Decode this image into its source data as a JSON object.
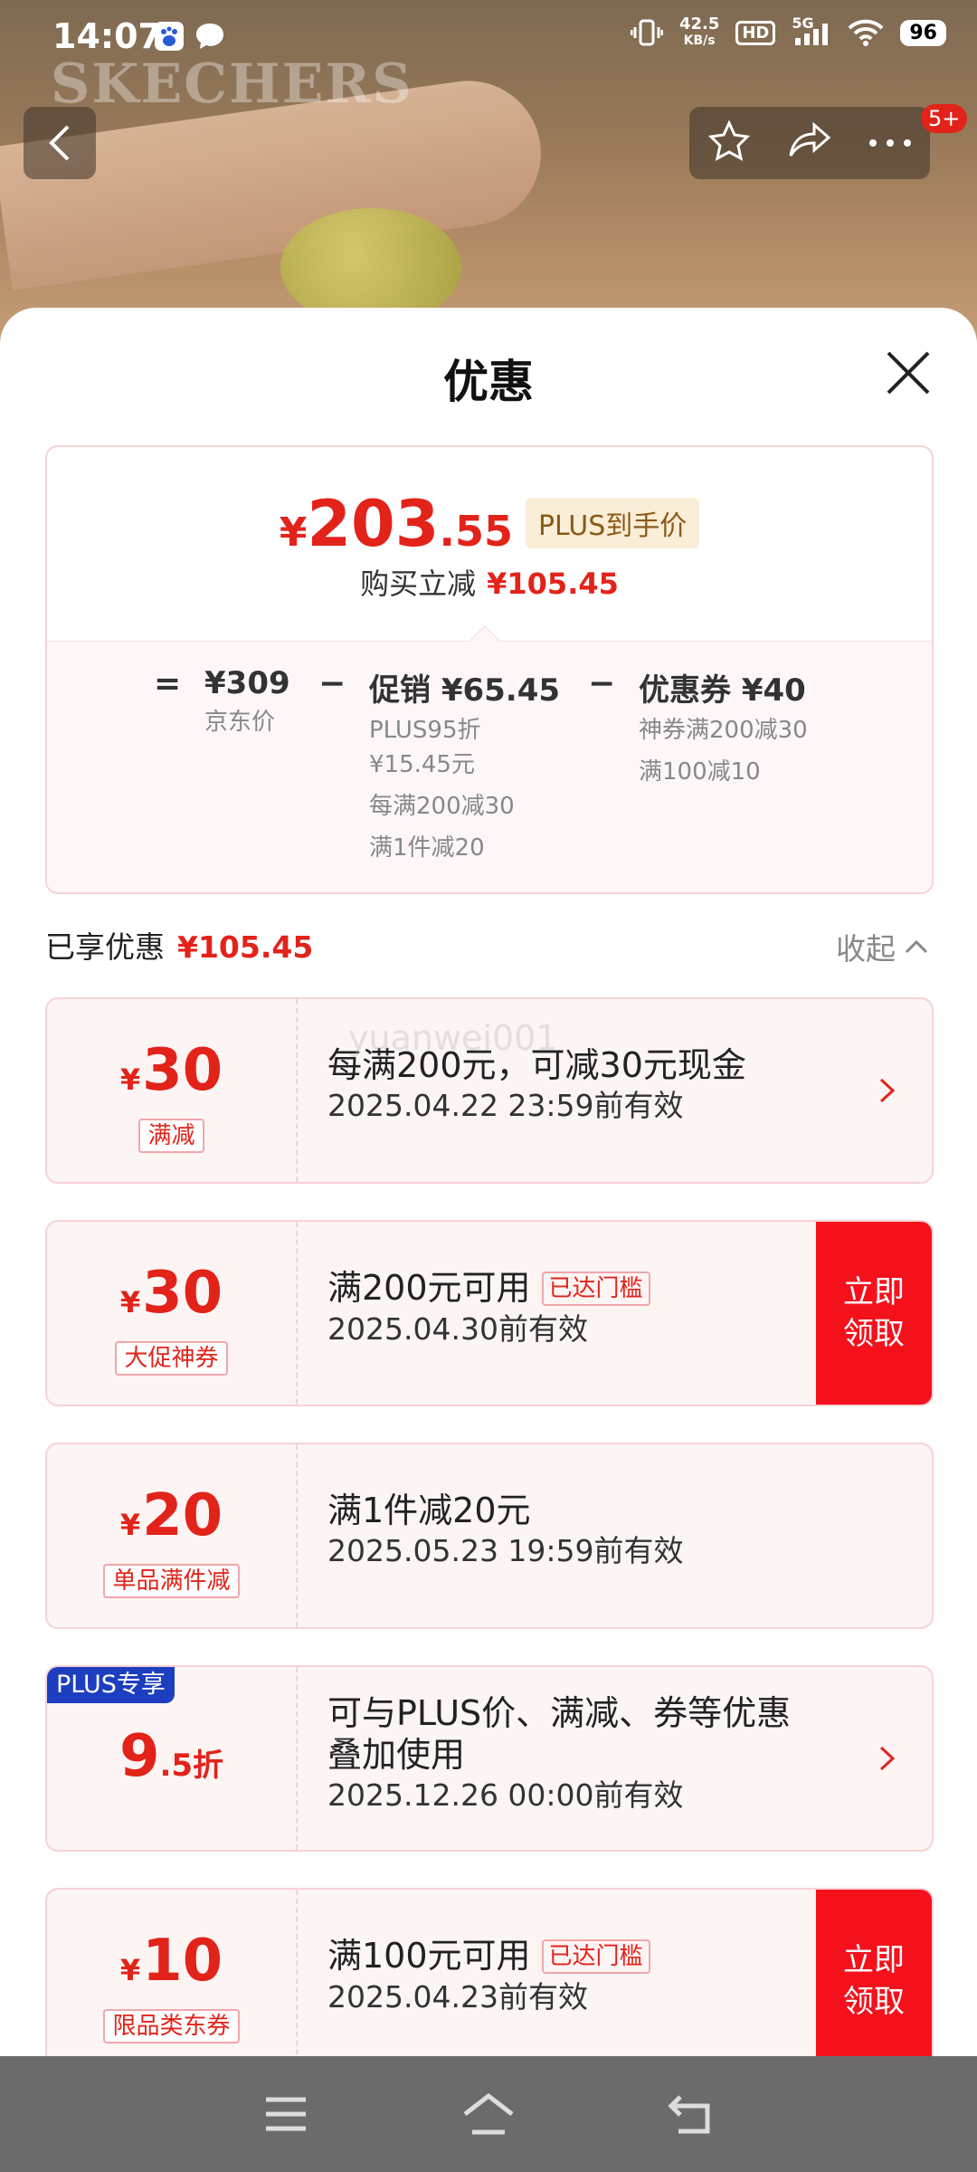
{
  "status_bar": {
    "time": "14:07",
    "net_speed_value": "42.5",
    "net_speed_unit": "KB/s",
    "hd": "HD",
    "network": "5G",
    "battery": "96"
  },
  "background": {
    "brand": "SKECHERS"
  },
  "top_nav": {
    "more_badge": "5+"
  },
  "sheet": {
    "title": "优惠"
  },
  "summary": {
    "currency": "¥",
    "final_price_int": "203",
    "final_price_dec": ".55",
    "plus_tag": "PLUS到手价",
    "buy_reduce_label": "购买立减",
    "buy_reduce_amount": "¥105.45",
    "equals": "=",
    "minus": "−",
    "jd_price": "¥309",
    "jd_price_label": "京东价",
    "promo_title": "促销 ¥65.45",
    "promo_lines": [
      "PLUS95折",
      "¥15.45元",
      "每满200减30",
      "满1件减20"
    ],
    "coupon_title": "优惠券 ¥40",
    "coupon_lines": [
      "神券满200减30",
      "满100减10"
    ]
  },
  "enjoyed": {
    "label": "已享优惠",
    "amount": "¥105.45",
    "collapse_label": "收起"
  },
  "watermark": "yuanwei001",
  "coupons": [
    {
      "amount": "30",
      "tag": "满减",
      "title": "每满200元，可减30元现金",
      "date": "2025.04.22 23:59前有效"
    },
    {
      "amount": "30",
      "tag": "大促神券",
      "title": "满200元可用",
      "badge": "已达门槛",
      "date": "2025.04.30前有效",
      "button": "立即领取"
    },
    {
      "amount": "20",
      "tag": "单品满件减",
      "title": "满1件减20元",
      "date": "2025.05.23 19:59前有效"
    },
    {
      "amount_int": "9",
      "amount_suffix": ".5折",
      "top_badge": "PLUS专享",
      "title_line1": "可与PLUS价、满减、券等优惠",
      "title_line2": "叠加使用",
      "date": "2025.12.26 00:00前有效"
    },
    {
      "amount": "10",
      "tag": "限品类东券",
      "title": "满100元可用",
      "badge": "已达门槛",
      "date": "2025.04.23前有效",
      "button": "立即领取"
    }
  ],
  "yen_symbol": "¥",
  "colors": {
    "accent_red": "#e2231a",
    "button_red": "#f5111c",
    "plus_blue": "#1d3fbf",
    "plus_tag_bg": "#fbeed8"
  }
}
